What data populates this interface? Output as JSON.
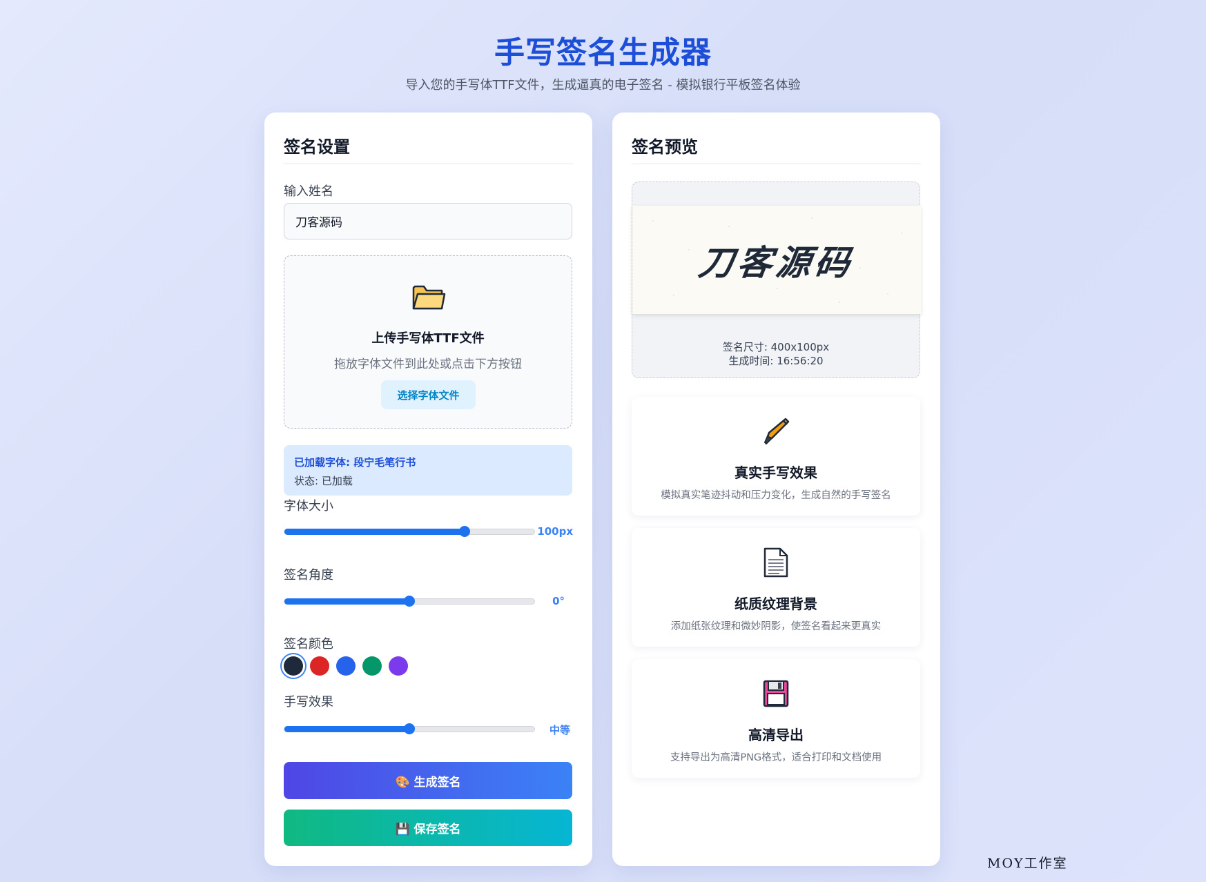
{
  "header": {
    "title": "手写签名生成器",
    "subtitle": "导入您的手写体TTF文件，生成逼真的电子签名 - 模拟银行平板签名体验"
  },
  "settings": {
    "heading": "签名设置",
    "name_label": "输入姓名",
    "name_value": "刀客源码",
    "upload": {
      "icon": "folder-icon",
      "title": "上传手写体TTF文件",
      "hint": "拖放字体文件到此处或点击下方按钮",
      "button": "选择字体文件"
    },
    "font_info": {
      "loaded": "已加载字体: 段宁毛笔行书",
      "status": "状态: 已加载"
    },
    "font_size": {
      "label": "字体大小",
      "value": "100px",
      "fraction": 0.72
    },
    "angle": {
      "label": "签名角度",
      "value": "0°",
      "fraction": 0.5
    },
    "color": {
      "label": "签名颜色",
      "swatches": [
        "#1e293b",
        "#dc2626",
        "#2563eb",
        "#059669",
        "#7c3aed"
      ],
      "selected_index": 0
    },
    "effect": {
      "label": "手写效果",
      "value": "中等",
      "fraction": 0.5
    },
    "generate_button": {
      "icon": "palette-icon",
      "label": "生成签名"
    },
    "save_button": {
      "icon": "floppy-disk-icon",
      "label": "保存签名"
    }
  },
  "preview": {
    "heading": "签名预览",
    "signature_text": "刀客源码",
    "size_text": "签名尺寸: 400x100px",
    "time_text": "生成时间: 16:56:20"
  },
  "features": [
    {
      "icon": "fountain-pen-icon",
      "title": "真实手写效果",
      "desc": "模拟真实笔迹抖动和压力变化，生成自然的手写签名"
    },
    {
      "icon": "document-icon",
      "title": "纸质纹理背景",
      "desc": "添加纸张纹理和微妙阴影，使签名看起来更真实"
    },
    {
      "icon": "floppy-disk-icon",
      "title": "高清导出",
      "desc": "支持导出为高清PNG格式，适合打印和文档使用"
    }
  ],
  "footer": {
    "studio": "MOY工作室"
  },
  "colors": {
    "accent": "#1d4ed8",
    "slider": "#1d72f0",
    "generate_from": "#4f46e5",
    "generate_to": "#3b82f6",
    "save_from": "#10b981",
    "save_to": "#06b6d4"
  }
}
